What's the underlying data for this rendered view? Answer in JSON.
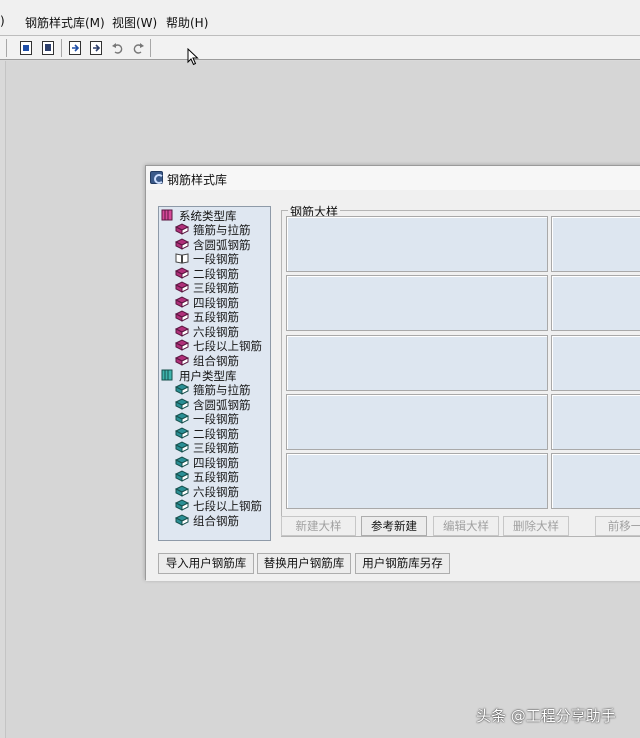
{
  "menubar": {
    "items": [
      {
        "label": ")"
      },
      {
        "label": "钢筋样式库(M)"
      },
      {
        "label": "视图(W)"
      },
      {
        "label": "帮助(H)"
      }
    ]
  },
  "toolbar": {
    "icons": [
      "document-icon",
      "document-copy-icon",
      "export-icon",
      "import-icon",
      "undo-icon",
      "redo-icon"
    ]
  },
  "dialog": {
    "title": "钢筋样式库",
    "tree": {
      "system": {
        "label": "系统类型库",
        "items": [
          "箍筋与拉筋",
          "含圆弧钢筋",
          "一段钢筋",
          "二段钢筋",
          "三段钢筋",
          "四段钢筋",
          "五段钢筋",
          "六段钢筋",
          "七段以上钢筋",
          "组合钢筋"
        ]
      },
      "user": {
        "label": "用户类型库",
        "items": [
          "箍筋与拉筋",
          "含圆弧钢筋",
          "一段钢筋",
          "二段钢筋",
          "三段钢筋",
          "四段钢筋",
          "五段钢筋",
          "六段钢筋",
          "七段以上钢筋",
          "组合钢筋"
        ]
      }
    },
    "group_label": "钢筋大样",
    "buttons": {
      "new_sample": "新建大样",
      "reference_new": "参考新建",
      "edit_sample": "编辑大样",
      "delete_sample": "删除大样",
      "move": "前移一"
    },
    "bottom_buttons": {
      "import_user_lib": "导入用户钢筋库",
      "replace_user_lib": "替换用户钢筋库",
      "save_user_lib_as": "用户钢筋库另存"
    }
  },
  "watermark": "头条 @工程分享助手",
  "colors": {
    "system_book": "#b0307a",
    "user_book": "#2a8f95",
    "cell_fill": "#dde6f0",
    "tree_bg": "#dfe7f1"
  }
}
